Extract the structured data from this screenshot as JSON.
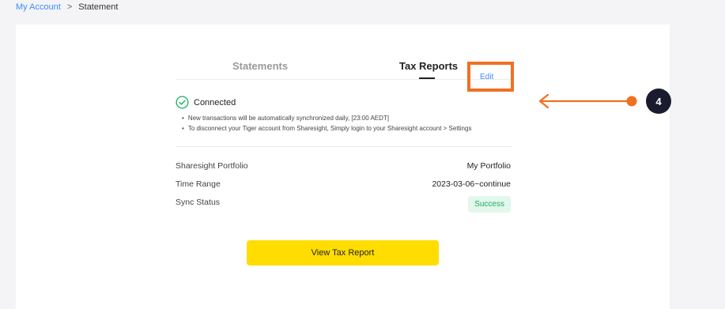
{
  "breadcrumb": {
    "parent": "My Account",
    "separator": ">",
    "current": "Statement"
  },
  "tabs": [
    {
      "label": "Statements",
      "active": false
    },
    {
      "label": "Tax Reports",
      "active": true
    }
  ],
  "connection": {
    "status": "Connected",
    "notes": [
      "New transactions will be automatically synchronized daily, [23:00 AEDT]",
      "To disconnect your Tiger account from Sharesight, Simply login to your Sharesight account > Settings"
    ],
    "edit_label": "Edit"
  },
  "details": {
    "portfolio_label": "Sharesight Portfolio",
    "portfolio_value": "My Portfolio",
    "time_range_label": "Time Range",
    "time_range_value": "2023-03-06~continue",
    "sync_label": "Sync Status",
    "sync_value": "Success"
  },
  "cta": {
    "label": "View Tax Report"
  },
  "annotation": {
    "step": "4"
  },
  "colors": {
    "accent_yellow": "#ffdd00",
    "link_blue": "#3d8bfd",
    "highlight_orange": "#f07023",
    "success_green": "#19b062",
    "badge_dark": "#1a1b2e"
  }
}
